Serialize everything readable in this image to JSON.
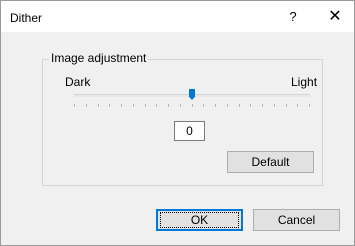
{
  "window": {
    "title": "Dither",
    "help_label": "?",
    "close_label": "✕"
  },
  "group": {
    "label": "Image adjustment",
    "dark_label": "Dark",
    "light_label": "Light",
    "value_text": "0",
    "slider_position_fraction": 0.5,
    "default_label": "Default"
  },
  "buttons": {
    "ok_label": "OK",
    "cancel_label": "Cancel"
  },
  "colors": {
    "accent": "#0078d7"
  }
}
